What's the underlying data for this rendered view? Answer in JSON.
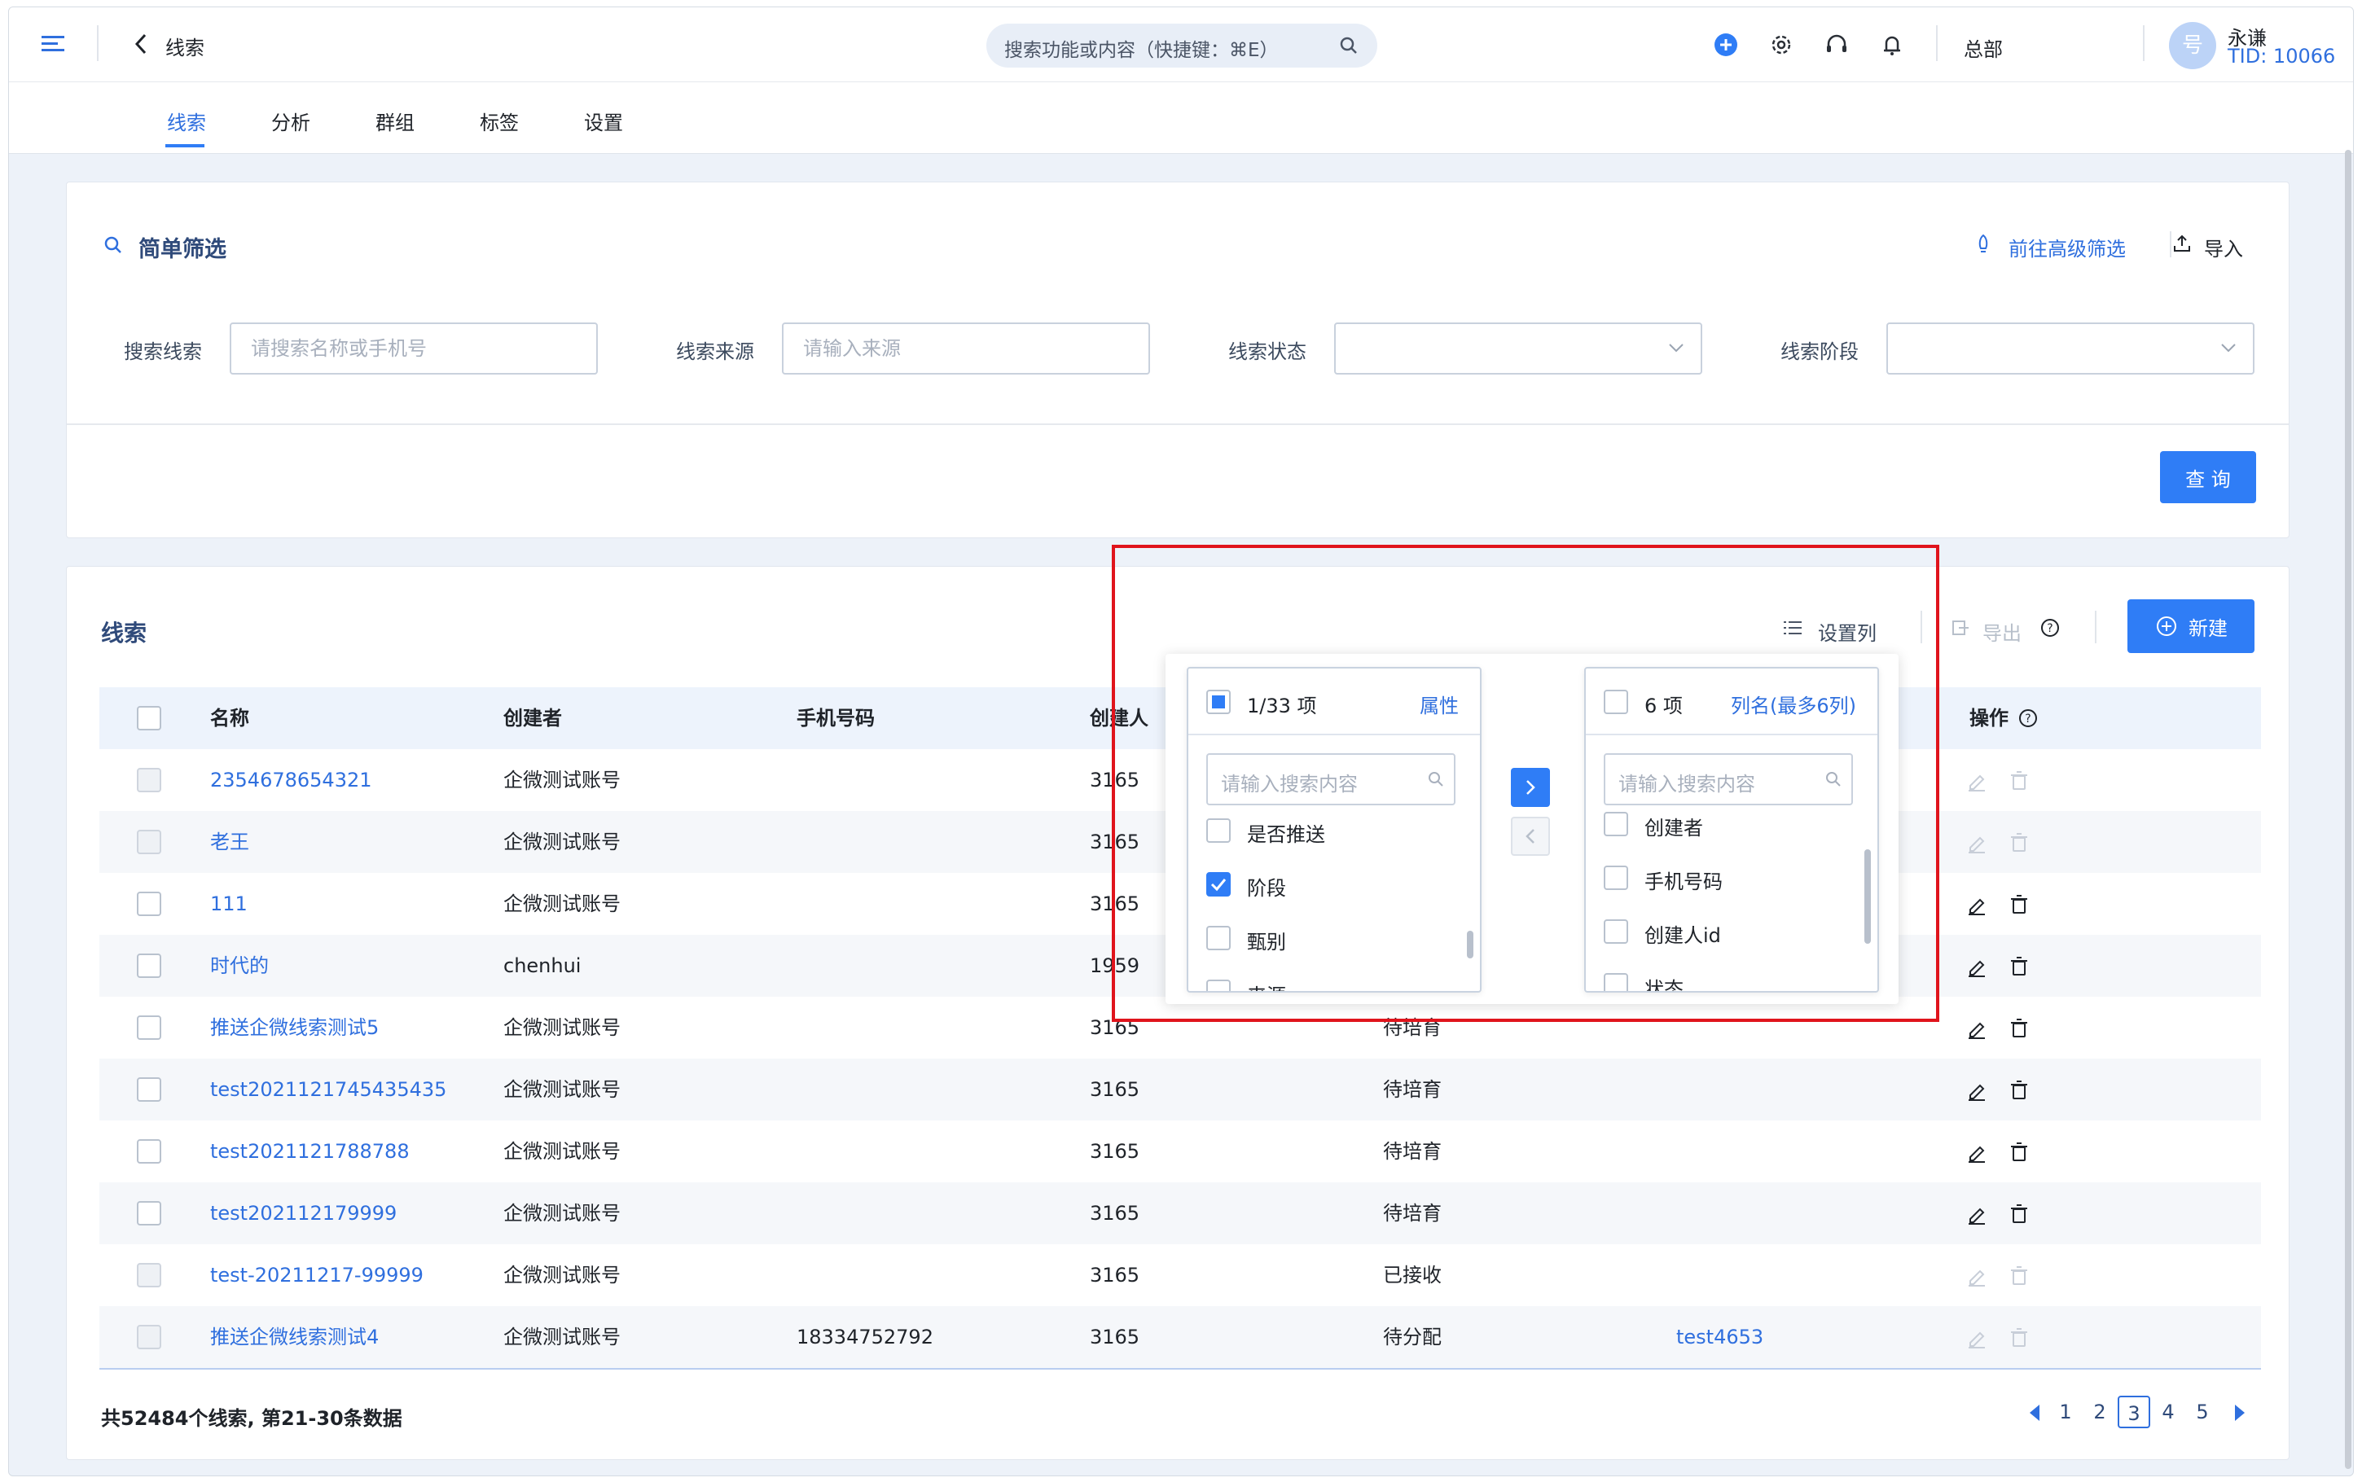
{
  "header": {
    "back_title": "线索",
    "search_placeholder": "搜索功能或内容（快捷键：⌘E）",
    "org": "总部",
    "user_name": "永谦",
    "user_tid": "TID: 10066",
    "avatar_char": "号"
  },
  "tabs": [
    "线索",
    "分析",
    "群组",
    "标签",
    "设置"
  ],
  "filter": {
    "title": "简单筛选",
    "advanced_link": "前往高级筛选",
    "import_label": "导入",
    "fields": [
      {
        "label": "搜索线索",
        "placeholder": "请搜索名称或手机号"
      },
      {
        "label": "线索来源",
        "placeholder": "请输入来源"
      },
      {
        "label": "线索状态",
        "placeholder": ""
      },
      {
        "label": "线索阶段",
        "placeholder": ""
      }
    ],
    "query_button": "查 询"
  },
  "list": {
    "title": "线索",
    "set_columns": "设置列",
    "export": "导出",
    "new_button": "新建",
    "columns": {
      "name": "名称",
      "creator": "创建者",
      "phone": "手机号码",
      "creator_id": "创建人id",
      "ops": "操作"
    },
    "rows": [
      {
        "name": "2354678654321",
        "creator": "企微测试账号",
        "phone": "",
        "creator_id": "3165",
        "status": "",
        "extra": "",
        "disabled": true
      },
      {
        "name": "老王",
        "creator": "企微测试账号",
        "phone": "",
        "creator_id": "3165",
        "status": "",
        "extra": "",
        "disabled": true
      },
      {
        "name": "111",
        "creator": "企微测试账号",
        "phone": "",
        "creator_id": "3165",
        "status": "",
        "extra": "",
        "disabled": false
      },
      {
        "name": "时代的",
        "creator": "chenhui",
        "phone": "",
        "creator_id": "1959",
        "status": "",
        "extra": "",
        "disabled": false
      },
      {
        "name": "推送企微线索测试5",
        "creator": "企微测试账号",
        "phone": "",
        "creator_id": "3165",
        "status": "待培育",
        "extra": "",
        "disabled": false
      },
      {
        "name": "test2021121745435435",
        "creator": "企微测试账号",
        "phone": "",
        "creator_id": "3165",
        "status": "待培育",
        "extra": "",
        "disabled": false
      },
      {
        "name": "test2021121788788",
        "creator": "企微测试账号",
        "phone": "",
        "creator_id": "3165",
        "status": "待培育",
        "extra": "",
        "disabled": false
      },
      {
        "name": "test202112179999",
        "creator": "企微测试账号",
        "phone": "",
        "creator_id": "3165",
        "status": "待培育",
        "extra": "",
        "disabled": false
      },
      {
        "name": "test-20211217-99999",
        "creator": "企微测试账号",
        "phone": "",
        "creator_id": "3165",
        "status": "已接收",
        "extra": "",
        "disabled": true
      },
      {
        "name": "推送企微线索测试4",
        "creator": "企微测试账号",
        "phone": "18334752792",
        "creator_id": "3165",
        "status": "待分配",
        "extra": "test4653",
        "disabled": true
      }
    ],
    "summary": "共52484个线索, 第21-30条数据",
    "pages": [
      "1",
      "2",
      "3",
      "4",
      "5"
    ],
    "current_page": "3"
  },
  "transfer": {
    "left_count": "1/33 项",
    "left_title": "属性",
    "left_search": "请输入搜索内容",
    "left_items": [
      {
        "label": "是否推送",
        "checked": false
      },
      {
        "label": "阶段",
        "checked": true
      },
      {
        "label": "甄别",
        "checked": false
      },
      {
        "label": "来源",
        "checked": false
      }
    ],
    "right_count": "6 项",
    "right_title": "列名(最多6列)",
    "right_search": "请输入搜索内容",
    "right_items": [
      {
        "label": "创建者",
        "checked": false
      },
      {
        "label": "手机号码",
        "checked": false
      },
      {
        "label": "创建人id",
        "checked": false
      },
      {
        "label": "状态",
        "checked": false
      }
    ]
  },
  "colors": {
    "accent": "#2f7df6",
    "link": "#2f6fde",
    "highlight_border": "#e0141c"
  }
}
